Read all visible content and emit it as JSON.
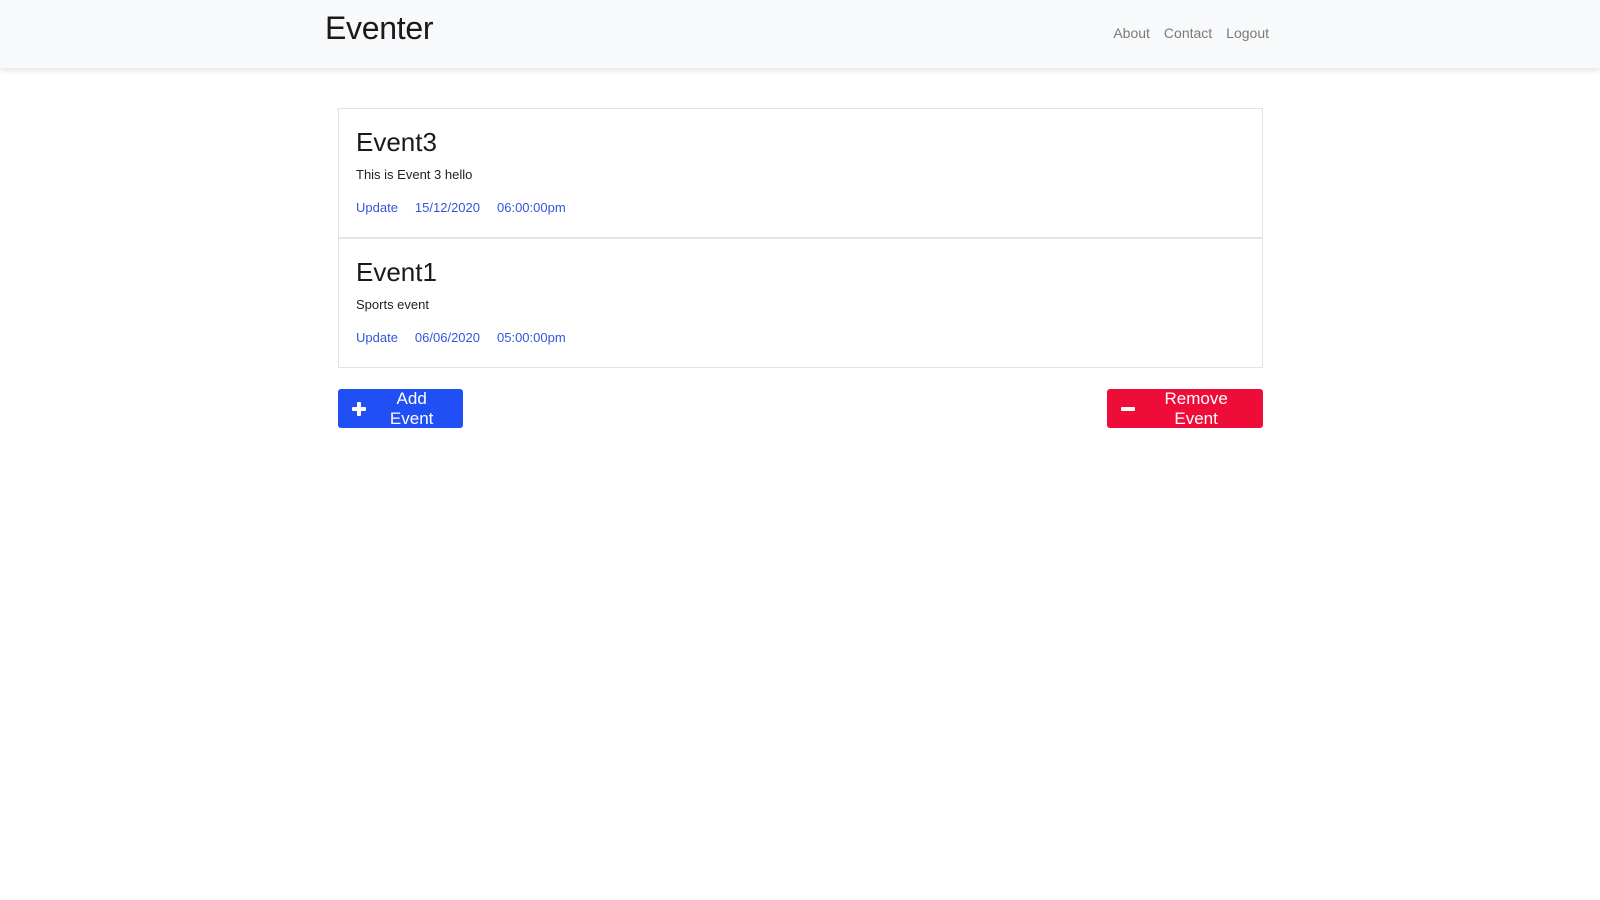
{
  "navbar": {
    "brand": "Eventer",
    "links": [
      "About",
      "Contact",
      "Logout"
    ]
  },
  "events": [
    {
      "title": "Event3",
      "description": "This is Event 3 hello",
      "update_label": "Update",
      "date": "15/12/2020",
      "time": "06:00:00pm"
    },
    {
      "title": "Event1",
      "description": "Sports event",
      "update_label": "Update",
      "date": "06/06/2020",
      "time": "05:00:00pm"
    }
  ],
  "actions": {
    "add_label": "Add Event",
    "add_icon": "plus-icon",
    "remove_label": "Remove Event",
    "remove_icon": "minus-icon"
  },
  "colors": {
    "primary": "#1f4ff5",
    "danger": "#ee0d39",
    "link": "#3355dd",
    "navbar_bg": "#f8f9fa"
  }
}
